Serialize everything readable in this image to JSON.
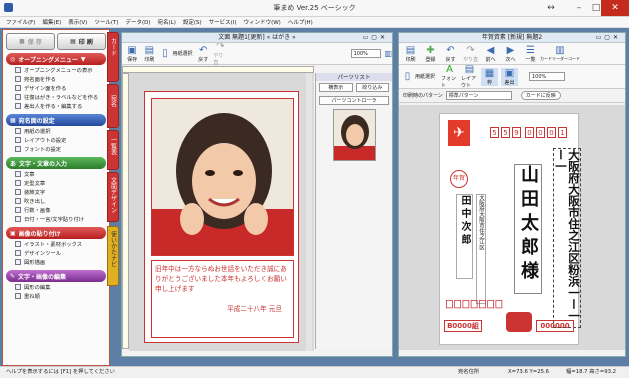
{
  "window_title": "筆まめ Ver.25 ベーシック",
  "menu": [
    "ファイル(F)",
    "編集(E)",
    "表示(V)",
    "ツール(T)",
    "データ(D)",
    "宛名(L)",
    "設定(S)",
    "サービス(I)",
    "ウィンドウ(W)",
    "ヘルプ(H)"
  ],
  "left": {
    "save": "保 存",
    "print": "印 刷",
    "sections": [
      {
        "title": "オープニングメニュー",
        "items": [
          "オープニングメニューの表示",
          "宛名面を作る",
          "デザイン面を作る",
          "往復はがき・ラベルなどを作る",
          "差出人を作る・編集する"
        ]
      },
      {
        "title": "宛名面の設定",
        "items": [
          "用紙の選択",
          "レイアウトの設定",
          "フォントの設定"
        ]
      },
      {
        "title": "文字・文章の入力",
        "items": [
          "文章",
          "定型文章",
          "装飾文字",
          "吹き出し",
          "行数・画像",
          "日付・一言/文字貼り付け"
        ]
      },
      {
        "title": "画像の貼り付け",
        "items": [
          "イラスト・素材ボックス",
          "デザインツール",
          "図形描画"
        ]
      },
      {
        "title": "文字・画像の編集",
        "items": [
          "図形の編集",
          "重ね順"
        ]
      }
    ],
    "tabs": [
      "カード",
      "宛名",
      "一覧表",
      "文面デザイン"
    ],
    "help_tab": "使いかたナビ"
  },
  "design_win": {
    "title": "文面 無題1[更新] « はがき »",
    "toolbar": [
      "保存",
      "印刷",
      "用紙選択",
      "戻す",
      "やり直"
    ],
    "zoom": "100%",
    "message": "旧年中は一方ならぬお世話をいただき誠にありがとうございました本年もよろしくお願い申し上げます",
    "date": "平成二十八年 元旦"
  },
  "parts": {
    "title": "パーツリスト",
    "show": "横表示",
    "narrow": "絞り込み",
    "controller": "パーツコントローラ"
  },
  "addr_win": {
    "title": "年賀資素 [新規] 無題2",
    "toolbar": [
      "印刷",
      "登録",
      "戻す",
      "やり直",
      "前へ",
      "次へ",
      "一覧",
      "カードリーダーコード"
    ],
    "toolbar2": [
      "用紙選択",
      "フォント",
      "レイアウト",
      "枠",
      "差出"
    ],
    "zoom": "100%",
    "pattern_label": "印刷時のパターン",
    "pattern": "標準パターン",
    "reflect": "カードに反映",
    "postal": [
      "5",
      "5",
      "9",
      "0",
      "0",
      "0",
      "1"
    ],
    "address": "大阪府大阪市住之江区粉浜一ー一ー一",
    "name": "山田太郎様",
    "sender_name": "田中次郎",
    "sender_address": "大阪府大阪市住之江区",
    "stamp": "年賀",
    "lottery_left": "B0000組",
    "lottery_right": "000000"
  },
  "status": {
    "help": "ヘルプを表示するには [F1] を押してください",
    "field": "宛名住所",
    "coords": "X=73.6 Y=25.6",
    "size": "幅=18.7 高さ=93.2"
  }
}
